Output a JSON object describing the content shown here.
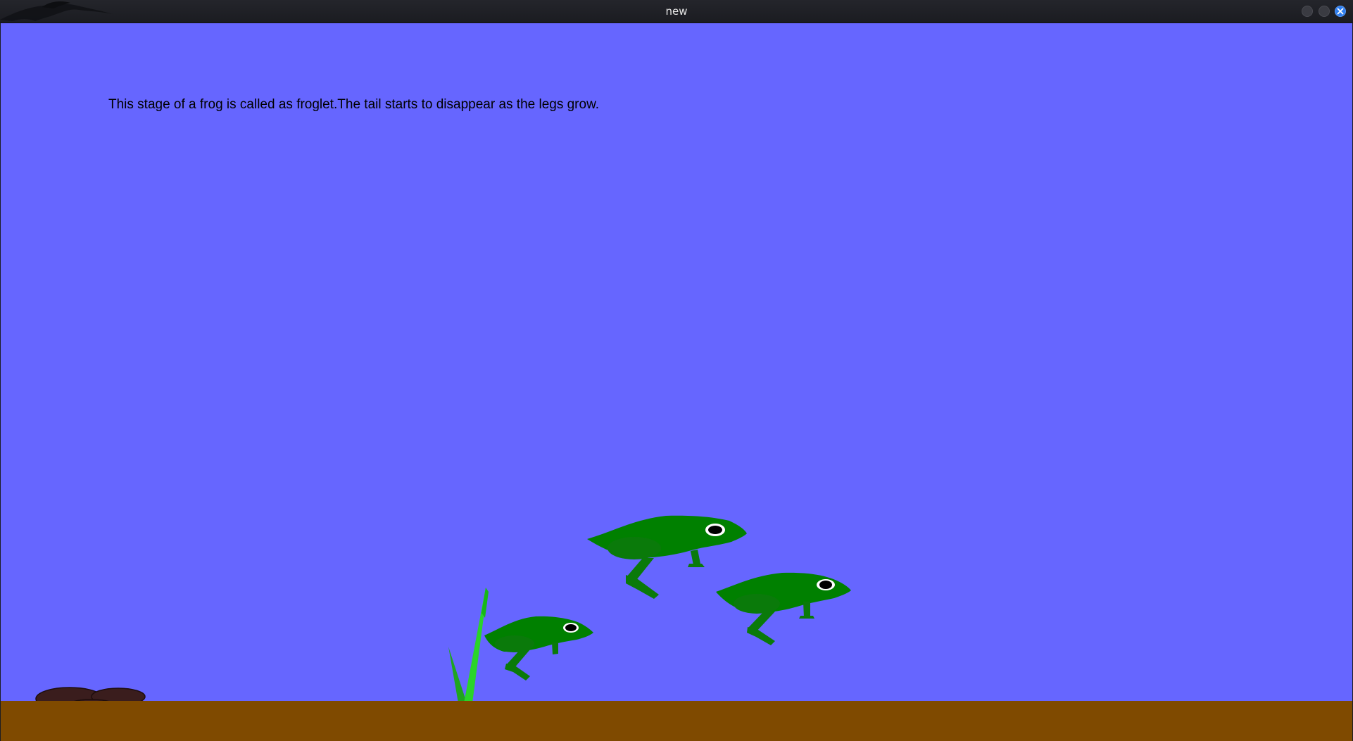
{
  "window": {
    "title": "new"
  },
  "scene": {
    "caption": "This stage of a frog is called as froglet.The tail starts to disappear as the legs grow.",
    "colors": {
      "sky": "#6666ff",
      "ground": "#7f4a00",
      "frog_body": "#008000",
      "frog_limb": "#0a7a0a",
      "grass": "#22cc22",
      "stones": "#3a1d1d"
    },
    "frog_count": 3
  }
}
